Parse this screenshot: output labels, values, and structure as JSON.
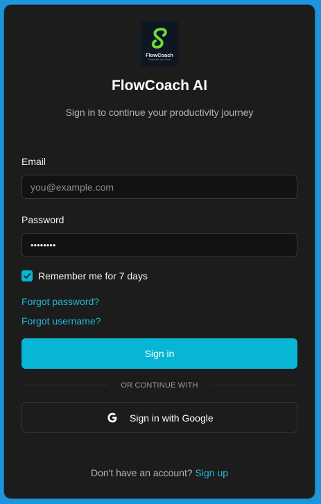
{
  "brand": {
    "logo_name": "FlowCoach",
    "logo_tagline": "Empower Your Flow",
    "logo_icon": "flow-s-icon",
    "accent_color": "#06b6d4",
    "background_color": "#1d95dd"
  },
  "header": {
    "title": "FlowCoach AI",
    "subtitle": "Sign in to continue your productivity journey"
  },
  "form": {
    "email": {
      "label": "Email",
      "placeholder": "you@example.com",
      "value": ""
    },
    "password": {
      "label": "Password",
      "value": "••••••••"
    },
    "remember": {
      "label": "Remember me for 7 days",
      "checked": true
    },
    "forgot_password": "Forgot password?",
    "forgot_username": "Forgot username?",
    "submit_label": "Sign in"
  },
  "divider": {
    "text": "OR CONTINUE WITH"
  },
  "social": {
    "google_label": "Sign in with Google",
    "google_icon": "google-icon"
  },
  "footer": {
    "prompt": "Don't have an account?",
    "signup_label": "Sign up"
  }
}
